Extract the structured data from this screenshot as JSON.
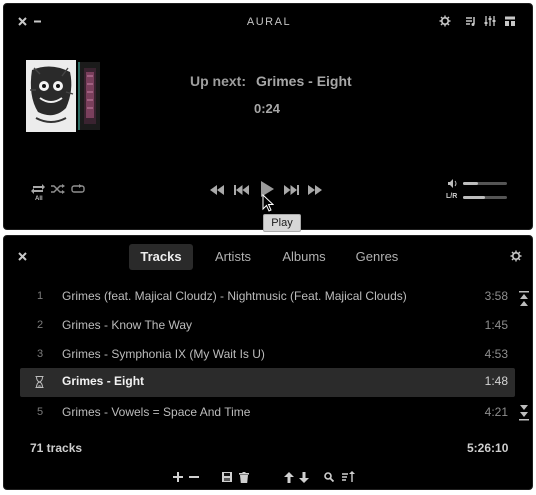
{
  "player": {
    "app_title": "AURAL",
    "up_next_label": "Up next:",
    "up_next_track": "Grimes - Eight",
    "elapsed": "0:24",
    "repeat_badge": "All",
    "volume_level": 0.35,
    "balance_label": "L/R",
    "balance_level": 0.5,
    "tooltip": "Play",
    "icons": {
      "close": "close-icon",
      "minimize": "minimize-icon",
      "settings": "gear-icon",
      "playlist_toggle": "playlist-icon",
      "equalizer": "equalizer-icon",
      "layout": "layout-icon",
      "repeat": "repeat-icon",
      "shuffle": "shuffle-icon",
      "loop": "loop-icon",
      "seek_back": "seek-backward-icon",
      "previous": "previous-track-icon",
      "play": "play-icon",
      "next": "next-track-icon",
      "seek_forward": "seek-forward-icon",
      "volume": "volume-icon"
    }
  },
  "playlist": {
    "tabs": [
      {
        "label": "Tracks",
        "active": true
      },
      {
        "label": "Artists",
        "active": false
      },
      {
        "label": "Albums",
        "active": false
      },
      {
        "label": "Genres",
        "active": false
      }
    ],
    "tracks": [
      {
        "num": "1",
        "title": "Grimes (feat. Majical Cloudz) - Nightmusic (Feat. Majical Clouds)",
        "duration": "3:58"
      },
      {
        "num": "2",
        "title": "Grimes - Know The Way",
        "duration": "1:45"
      },
      {
        "num": "3",
        "title": "Grimes - Symphonia IX (My Wait Is U)",
        "duration": "4:53"
      },
      {
        "num": "",
        "title": "Grimes - Eight",
        "duration": "1:48",
        "selected": true
      },
      {
        "num": "5",
        "title": "Grimes - Vowels = Space And Time",
        "duration": "4:21"
      }
    ],
    "track_count": "71 tracks",
    "total_duration": "5:26:10",
    "accent_selected_row": "#2b2b2b"
  }
}
